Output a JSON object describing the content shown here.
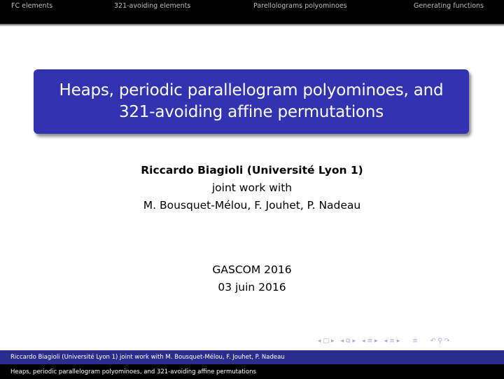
{
  "nav": {
    "sections": [
      "FC elements",
      "321-avoiding elements",
      "Parellolograms polyominoes",
      "Generating functions"
    ]
  },
  "title": {
    "line1": "Heaps, periodic parallelogram polyominoes, and",
    "line2": "321-avoiding affine permutations"
  },
  "authors": {
    "presenter": "Riccardo Biagioli (Université Lyon 1)",
    "joint": "joint work with",
    "coauthors": "M. Bousquet-Mélou, F. Jouhet, P. Nadeau"
  },
  "event": {
    "conference": "GASCOM 2016",
    "date": "03 juin 2016"
  },
  "controls": {
    "frame_prev": "◂",
    "frame": "□",
    "frame_next": "▸",
    "sub_prev": "◂",
    "sub": "⧉",
    "sub_next": "▸",
    "sec_prev": "◂",
    "sec": "≡",
    "sec_next": "▸",
    "subsec_prev": "◂",
    "subsec": "≡",
    "subsec_next": "▸",
    "align": "≡",
    "undo": "↶",
    "search": "⚲",
    "redo": "↷"
  },
  "footer": {
    "authors": "Riccardo Biagioli (Université Lyon 1) joint work with  M. Bousquet-Mélou, F. Jouhet, P. Nadeau",
    "title": "Heaps, periodic parallelogram polyominoes, and 321-avoiding affine permutations"
  },
  "colors": {
    "title_box": "#3333b2",
    "footer_author_bar": "#2c2c8c",
    "header_bar": "#000000"
  }
}
